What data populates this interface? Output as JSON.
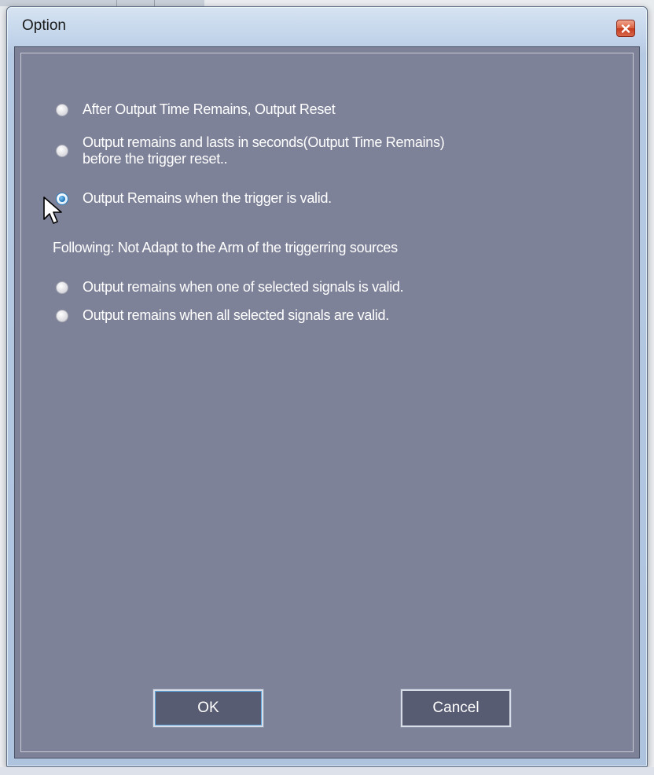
{
  "window": {
    "title": "Option",
    "close_icon": "close-icon"
  },
  "options": [
    {
      "label": "After Output Time Remains, Output Reset",
      "checked": false
    },
    {
      "label": "Output remains and lasts in seconds(Output Time Remains)\nbefore the trigger reset..",
      "checked": false
    },
    {
      "label": "Output Remains when the trigger is valid.",
      "checked": true
    },
    {
      "label": "Output remains when one of selected signals is valid.",
      "checked": false
    },
    {
      "label": "Output remains when all selected signals are valid.",
      "checked": false
    }
  ],
  "following_label": "Following: Not Adapt to the Arm of the triggerring sources",
  "buttons": {
    "ok_label": "OK",
    "cancel_label": "Cancel"
  },
  "colors": {
    "client_background": "#7e8299",
    "button_background": "#585c72",
    "selected_radio": "#1e73b8"
  }
}
